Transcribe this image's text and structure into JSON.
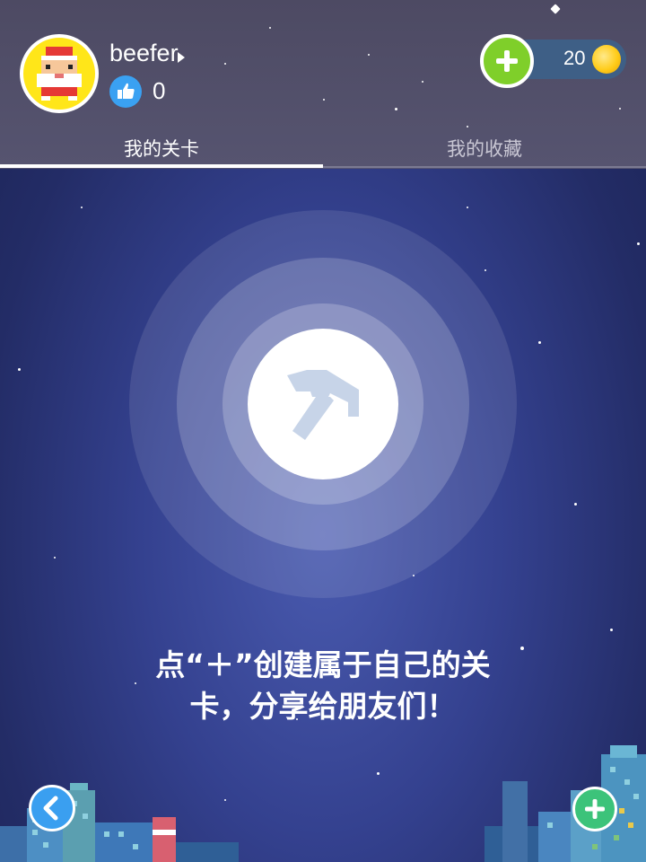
{
  "profile": {
    "username": "beefer",
    "likes": "0"
  },
  "currency": {
    "coins": "20"
  },
  "tabs": [
    {
      "label": "我的关卡",
      "active": true
    },
    {
      "label": "我的收藏",
      "active": false
    }
  ],
  "empty_state": {
    "line1": "点“＋”创建属于自己的关",
    "line2": "卡，分享给朋友们！"
  },
  "icons": {
    "avatar": "pixel-santa-avatar",
    "like": "thumbs-up-icon",
    "add_coins": "plus-icon",
    "coin": "gold-coin-icon",
    "hammer": "hammer-icon",
    "back": "chevron-left-icon",
    "add_level": "plus-icon"
  },
  "colors": {
    "header_bg": "#565470",
    "add_coins": "#7fcf2a",
    "like": "#3aa1f2",
    "back_button": "#3a9ff0",
    "add_level": "#3cc37a",
    "coin": "#ffcc1a"
  }
}
